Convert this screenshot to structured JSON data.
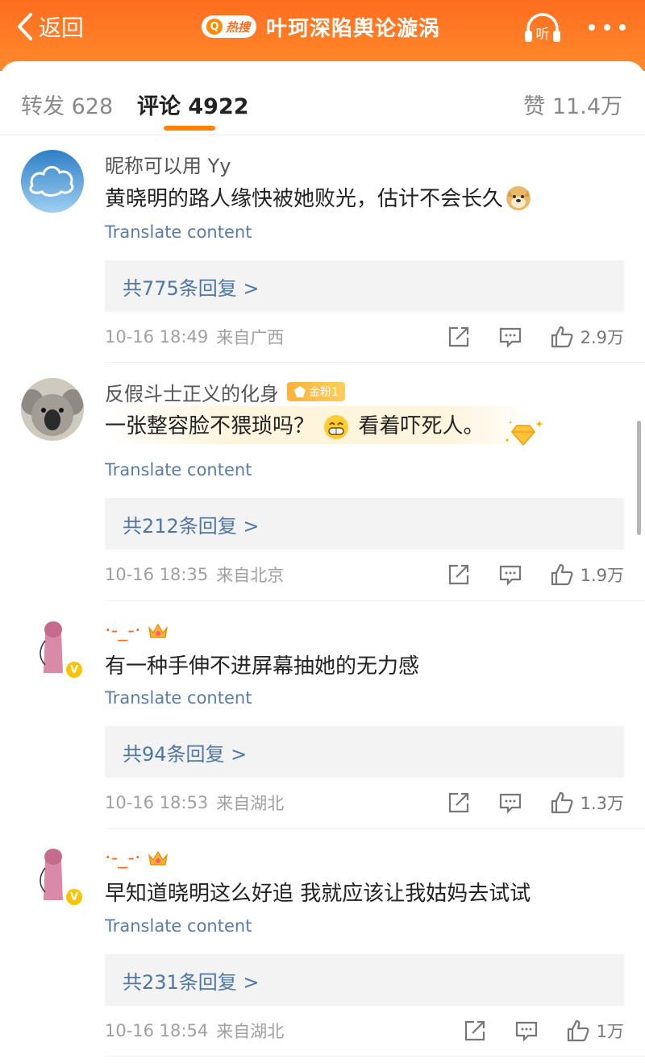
{
  "header": {
    "back_label": "返回",
    "hot_badge": "热搜",
    "title": "叶珂深陷舆论漩涡",
    "listen_label": "听",
    "accent_color": "#ff6d1f"
  },
  "tabs": {
    "repost": "转发 628",
    "comment": "评论 4922",
    "like": "赞 11.4万"
  },
  "comments": [
    {
      "nickname": "昵称可以用 Yy",
      "text": "黄晓明的路人缘快被她败光，估计不会长久",
      "emoji": "doge-emoji",
      "translate": "Translate content",
      "replies": "共775条回复 >",
      "time": "10-16 18:49",
      "location": "来自广西",
      "likes": "2.9万"
    },
    {
      "nickname": "反假斗士正义的化身",
      "fan_badge": "金粉1",
      "text_before": "一张整容脸不猥琐吗？",
      "text_after": "看着吓死人。",
      "emoji": "grin-emoji",
      "translate": "Translate content",
      "replies": "共212条回复 >",
      "time": "10-16 18:35",
      "location": "来自北京",
      "likes": "1.9万"
    },
    {
      "nickname": "·-_-·",
      "text": "有一种手伸不进屏幕抽她的无力感",
      "translate": "Translate content",
      "replies": "共94条回复 >",
      "time": "10-16 18:53",
      "location": "来自湖北",
      "likes": "1.3万"
    },
    {
      "nickname": "·-_-·",
      "text": "早知道晓明这么好追 我就应该让我姑妈去试试",
      "translate": "Translate content",
      "replies": "共231条回复 >",
      "time": "10-16 18:54",
      "location": "来自湖北",
      "likes": "1万"
    }
  ]
}
